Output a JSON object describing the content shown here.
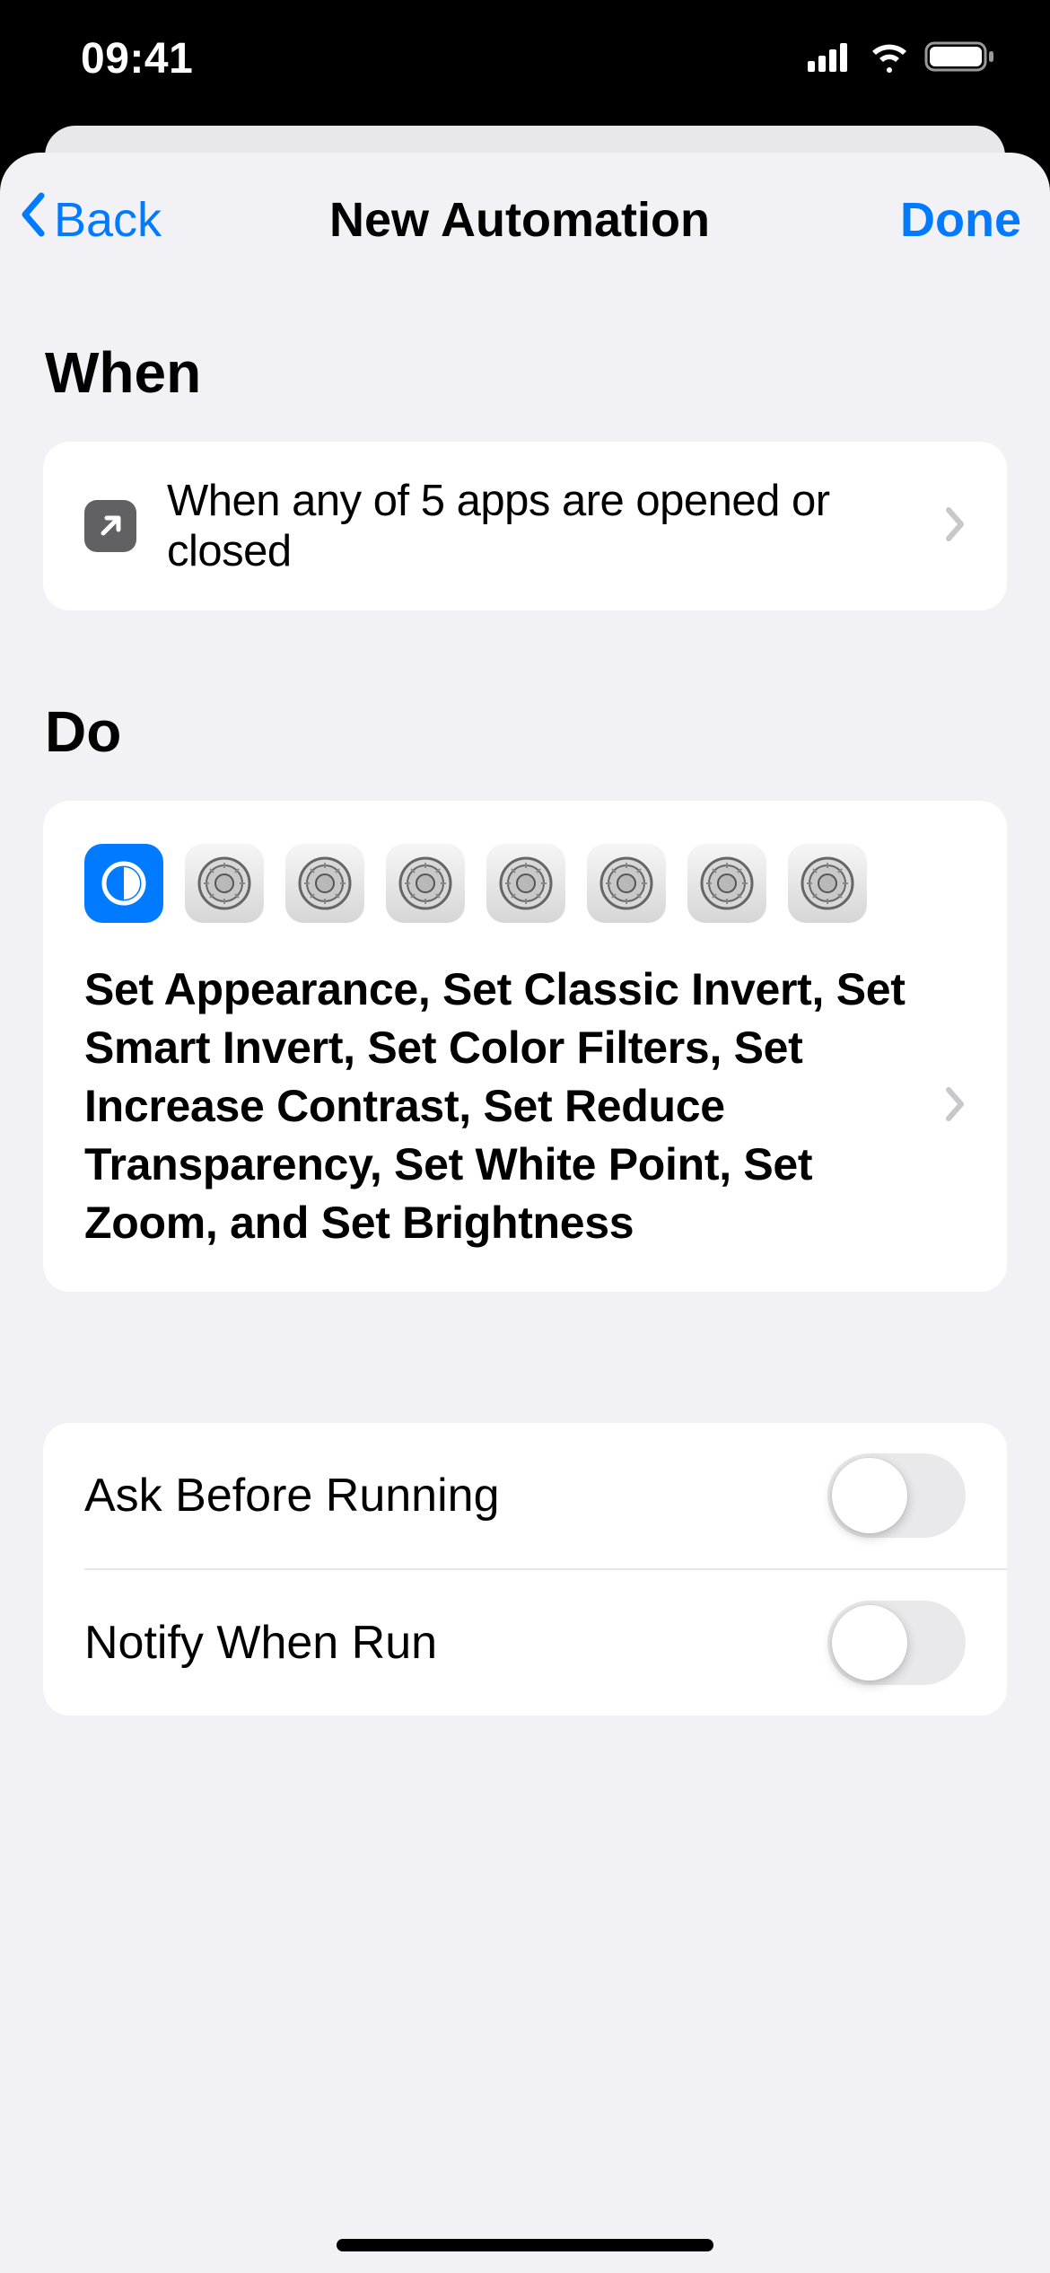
{
  "statusBar": {
    "time": "09:41"
  },
  "nav": {
    "back": "Back",
    "title": "New Automation",
    "done": "Done"
  },
  "sections": {
    "when": "When",
    "do": "Do"
  },
  "when": {
    "description": "When any of 5 apps are opened or closed"
  },
  "do": {
    "description": "Set Appearance, Set Classic Invert, Set Smart Invert, Set Color Filters, Set Increase Contrast, Set Reduce Transparency, Set White Point, Set Zoom, and Set Brightness",
    "iconCount": 8
  },
  "options": {
    "askBeforeRunning": {
      "label": "Ask Before Running",
      "enabled": false
    },
    "notifyWhenRun": {
      "label": "Notify When Run",
      "enabled": false
    }
  }
}
